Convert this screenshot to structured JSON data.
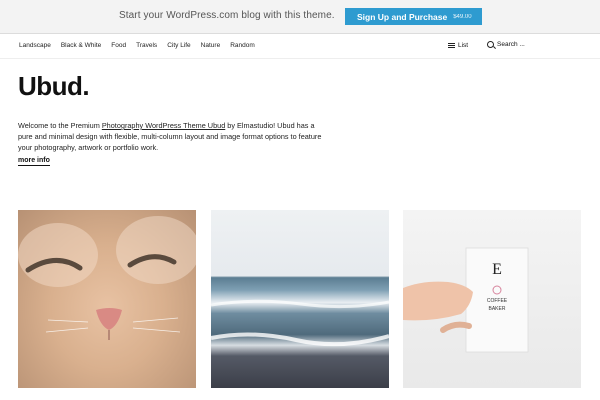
{
  "promo": {
    "text": "Start your WordPress.com blog with this theme.",
    "button_label": "Sign Up and Purchase",
    "price": "$49.00",
    "accent_color": "#2e9bd0"
  },
  "nav": {
    "items": [
      "Landscape",
      "Black & White",
      "Food",
      "Travels",
      "City Life",
      "Nature",
      "Random"
    ],
    "list_label": "List",
    "search_placeholder": "Search ..."
  },
  "hero": {
    "title": "Ubud.",
    "intro_before": "Welcome to the Premium ",
    "intro_link": "Photography WordPress Theme Ubud",
    "intro_after": " by Elmastudio! Ubud has a pure and minimal design with flexible, multi-column layout and image format options to feature your photography, artwork or portfolio work.",
    "more_info": "more info"
  },
  "gallery": {
    "card": {
      "letter": "E",
      "line1": "COFFEE",
      "line2": "BAKER"
    }
  }
}
